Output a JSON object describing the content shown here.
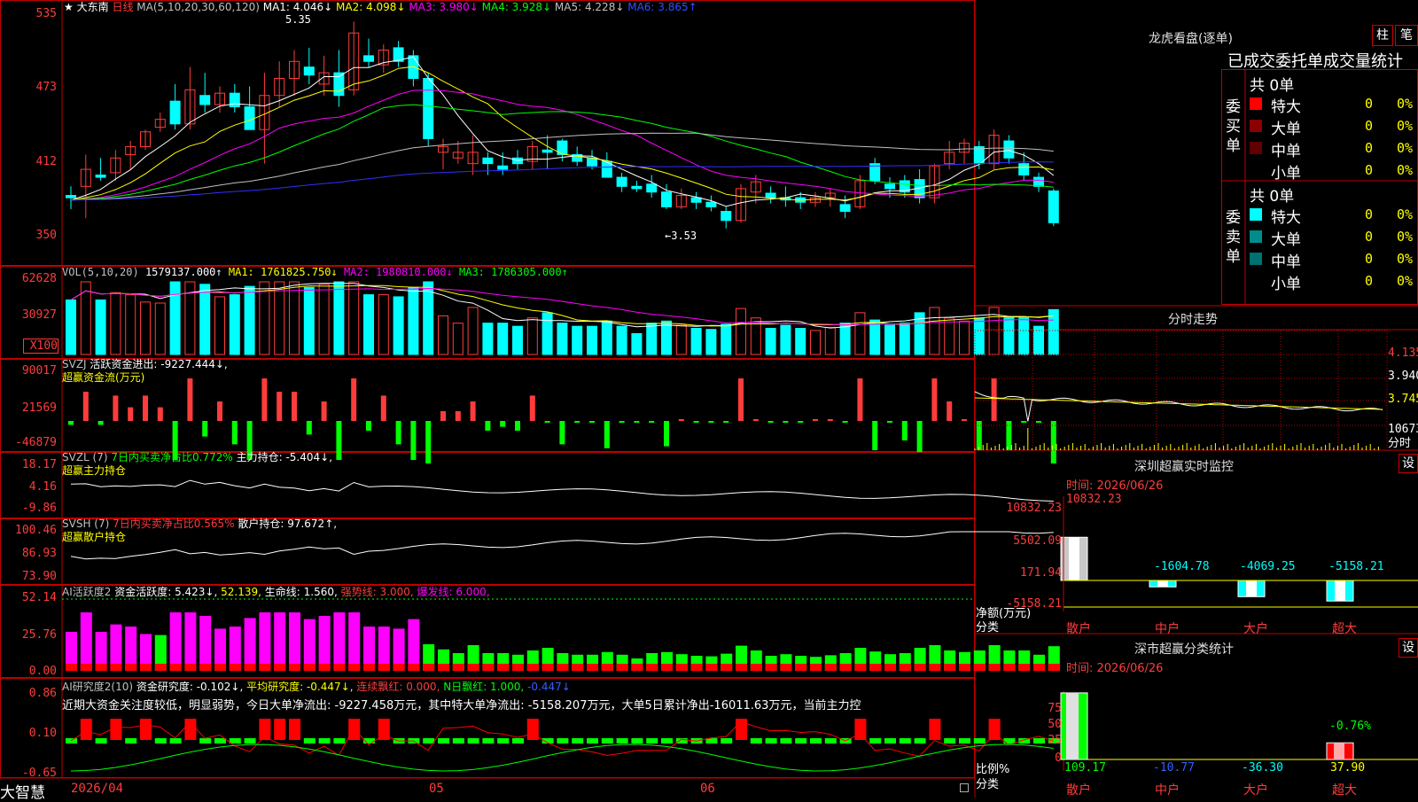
{
  "colors": {
    "up": "#ff3c3c",
    "down": "#00ffff",
    "frame": "#c00000",
    "ma5": "#ffffff",
    "ma10": "#ffff00",
    "ma20": "#ff00ff",
    "ma30": "#00ff00",
    "ma60": "#c0c0c0",
    "ma120": "#3030ff"
  },
  "header": {
    "stock_name": "大东南",
    "period": "日线",
    "ma_params": "MA(5,10,20,30,60,120)",
    "ma1": "MA1: 4.046↓",
    "ma2": "MA2: 4.098↓",
    "ma3": "MA3: 3.980↓",
    "ma4": "MA4: 3.928↓",
    "ma5": "MA5: 4.228↓",
    "ma6": "MA6: 3.865↑",
    "high_mark": "5.35",
    "low_mark": "←3.53"
  },
  "price_axis": [
    "535",
    "473",
    "412",
    "350"
  ],
  "vol": {
    "title": "VOL(5,10,20)",
    "value": "1579137.000↑",
    "ma1": "MA1: 1761825.750↓",
    "ma2": "MA2: 1980810.000↓",
    "ma3": "MA3: 1786305.000↑",
    "axis": [
      "62628",
      "30927"
    ],
    "unit": "X100"
  },
  "svzj": {
    "title": "SVZJ",
    "label": "活跃资金进出: -9227.444↓,",
    "sub": "超赢资金流(万元)",
    "axis": [
      "90017",
      "21569",
      "-46879"
    ]
  },
  "svzl": {
    "title": "SVZL (7)",
    "ratio": "7日内买卖净占比0.772%",
    "label": "主力持仓: -5.404↓,",
    "sub": "超赢主力持仓",
    "axis": [
      "18.17",
      "4.16",
      "-9.86"
    ]
  },
  "svsh": {
    "title": "SVSH (7)",
    "ratio": "7日内买卖净占比0.565%",
    "label": "散户持仓: 97.672↑,",
    "sub": "超赢散户持仓",
    "axis": [
      "100.46",
      "86.93",
      "73.90"
    ]
  },
  "ai2": {
    "title": "AI活跃度2",
    "label": "资金活跃度: 5.423↓,",
    "v2": "52.139,",
    "life": "生命线: 1.560,",
    "strong": "强势线: 3.000,",
    "burst": "爆发线: 6.000,",
    "axis": [
      "52.14",
      "25.76",
      "0.00"
    ]
  },
  "ai_res": {
    "title": "AI研究度2(10)",
    "label": "资金研究度: -0.102↓,",
    "avg": "平均研究度: -0.447↓,",
    "cont": "连续飘红: 0.000,",
    "nday": "N日飘红: 1.000,",
    "last": "-0.447↓",
    "axis": [
      "0.86",
      "0.10",
      "-0.65"
    ],
    "comment": "近期大资金关注度较低，明显弱势，今日大单净流出: -9227.458万元，其中特大单净流出: -5158.207万元，大单5日累计净出-16011.63万元，当前主力控"
  },
  "dates": [
    "2026/04",
    "05",
    "06"
  ],
  "brand": "大智慧",
  "right": {
    "lh_title": "龙虎看盘(逐单)",
    "btn1": "柱",
    "btn2": "笔",
    "table_title": "已成交委托单成交量统计",
    "buy_label": "委买单",
    "sell_label": "委卖单",
    "buy_total": "共 0单",
    "sell_total": "共 0单",
    "buy_rows": [
      {
        "name": "特大",
        "count": "0",
        "pct": "0%"
      },
      {
        "name": "大单",
        "count": "0",
        "pct": "0%"
      },
      {
        "name": "中单",
        "count": "0",
        "pct": "0%"
      },
      {
        "name": "小单",
        "count": "0",
        "pct": "0%"
      }
    ],
    "sell_rows": [
      {
        "name": "特大",
        "count": "0",
        "pct": "0%"
      },
      {
        "name": "大单",
        "count": "0",
        "pct": "0%"
      },
      {
        "name": "中单",
        "count": "0",
        "pct": "0%"
      },
      {
        "name": "小单",
        "count": "0",
        "pct": "0%"
      }
    ],
    "fs_title": "分时走势",
    "fs_axis": [
      "4.135",
      "3.940",
      "3.745",
      "10673"
    ],
    "fs_unit": "分时",
    "monitor_title": "深圳超赢实时监控",
    "monitor_btn": "设",
    "monitor_time": "时间: 2026/06/26",
    "monitor_axis": [
      "10832.23",
      "5502.09",
      "171.94",
      "-5158.21"
    ],
    "monitor_top": "10832.23",
    "monitor_values": [
      {
        "label": "散户",
        "value": "10832.23",
        "num": 10832.23
      },
      {
        "label": "中户",
        "value": "-1604.78",
        "num": -1604.78
      },
      {
        "label": "大户",
        "value": "-4069.25",
        "num": -4069.25
      },
      {
        "label": "超大",
        "value": "-5158.21",
        "num": -5158.21
      }
    ],
    "monitor_ylabel": "净额(万元)",
    "monitor_xlabel": "分类",
    "stat_title": "深市超赢分类统计",
    "stat_btn": "设",
    "stat_time": "时间: 2026/06/26",
    "stat_axis": [
      "75",
      "50",
      "25",
      "0"
    ],
    "stat_ylabel": "比例%",
    "stat_xlabel": "分类",
    "stat_values": [
      {
        "label": "散户",
        "value": "109.17",
        "num": 109.17
      },
      {
        "label": "中户",
        "value": "-10.77",
        "num": -10.77
      },
      {
        "label": "大户",
        "value": "-36.30",
        "num": -36.3
      },
      {
        "label": "超大",
        "value": "37.90",
        "num": 37.9
      }
    ],
    "stat_top": "-0.76%"
  },
  "chart_data": {
    "type": "bar",
    "title": "大东南 日线",
    "candles": [
      [
        3.82,
        3.9,
        3.7,
        3.8
      ],
      [
        3.9,
        4.18,
        3.62,
        4.05
      ],
      [
        4.0,
        4.15,
        3.95,
        3.98
      ],
      [
        4.02,
        4.22,
        3.95,
        4.15
      ],
      [
        4.18,
        4.3,
        4.05,
        4.25
      ],
      [
        4.25,
        4.4,
        4.22,
        4.38
      ],
      [
        4.42,
        4.55,
        4.38,
        4.49
      ],
      [
        4.65,
        4.8,
        4.4,
        4.45
      ],
      [
        4.45,
        4.95,
        4.4,
        4.75
      ],
      [
        4.7,
        4.9,
        4.55,
        4.62
      ],
      [
        4.62,
        4.78,
        4.55,
        4.72
      ],
      [
        4.72,
        4.8,
        4.55,
        4.6
      ],
      [
        4.6,
        4.78,
        4.45,
        4.4
      ],
      [
        4.4,
        4.9,
        4.1,
        4.7
      ],
      [
        4.7,
        5.0,
        4.6,
        4.85
      ],
      [
        4.85,
        5.1,
        4.7,
        5.0
      ],
      [
        4.95,
        5.12,
        4.8,
        4.88
      ],
      [
        4.8,
        5.05,
        4.7,
        4.9
      ],
      [
        4.9,
        5.1,
        4.6,
        4.7
      ],
      [
        4.75,
        5.35,
        4.7,
        5.25
      ],
      [
        5.05,
        5.2,
        4.95,
        5.0
      ],
      [
        4.97,
        5.15,
        4.9,
        5.1
      ],
      [
        5.12,
        5.18,
        4.95,
        5.0
      ],
      [
        5.05,
        5.1,
        4.78,
        4.85
      ],
      [
        4.85,
        4.9,
        4.25,
        4.32
      ],
      [
        4.2,
        4.32,
        4.05,
        4.25
      ],
      [
        4.15,
        4.3,
        4.1,
        4.2
      ],
      [
        4.1,
        4.35,
        4.0,
        4.2
      ],
      [
        4.15,
        4.2,
        4.0,
        4.1
      ],
      [
        4.08,
        4.2,
        4.0,
        4.05
      ],
      [
        4.15,
        4.22,
        4.05,
        4.1
      ],
      [
        4.12,
        4.3,
        4.05,
        4.25
      ],
      [
        4.22,
        4.35,
        4.05,
        4.2
      ],
      [
        4.3,
        4.32,
        4.12,
        4.18
      ],
      [
        4.18,
        4.25,
        4.08,
        4.12
      ],
      [
        4.15,
        4.22,
        4.05,
        4.08
      ],
      [
        4.12,
        4.2,
        3.98,
        3.98
      ],
      [
        3.98,
        4.02,
        3.85,
        3.9
      ],
      [
        3.9,
        3.95,
        3.85,
        3.88
      ],
      [
        3.92,
        4.0,
        3.8,
        3.85
      ],
      [
        3.85,
        3.92,
        3.7,
        3.72
      ],
      [
        3.72,
        3.88,
        3.7,
        3.82
      ],
      [
        3.8,
        3.85,
        3.7,
        3.76
      ],
      [
        3.76,
        3.82,
        3.68,
        3.72
      ],
      [
        3.68,
        3.72,
        3.53,
        3.6
      ],
      [
        3.6,
        3.92,
        3.58,
        3.88
      ],
      [
        3.85,
        4.0,
        3.75,
        3.94
      ],
      [
        3.84,
        3.9,
        3.75,
        3.8
      ],
      [
        3.8,
        3.9,
        3.72,
        3.78
      ],
      [
        3.8,
        3.85,
        3.7,
        3.76
      ],
      [
        3.76,
        3.85,
        3.72,
        3.8
      ],
      [
        3.8,
        3.88,
        3.72,
        3.84
      ],
      [
        3.74,
        3.82,
        3.62,
        3.68
      ],
      [
        3.72,
        4.0,
        3.7,
        3.95
      ],
      [
        4.1,
        4.15,
        3.92,
        3.95
      ],
      [
        3.92,
        3.98,
        3.8,
        3.88
      ],
      [
        3.95,
        4.0,
        3.8,
        3.85
      ],
      [
        3.96,
        4.05,
        3.75,
        3.8
      ],
      [
        3.8,
        4.1,
        3.75,
        4.08
      ],
      [
        4.1,
        4.3,
        4.05,
        4.2
      ],
      [
        4.2,
        4.32,
        4.1,
        4.28
      ],
      [
        4.25,
        4.3,
        4.05,
        4.1
      ],
      [
        4.1,
        4.4,
        4.05,
        4.35
      ],
      [
        4.3,
        4.35,
        4.1,
        4.15
      ],
      [
        4.1,
        4.2,
        3.95,
        4.0
      ],
      [
        3.98,
        4.02,
        3.85,
        3.9
      ],
      [
        3.86,
        3.88,
        3.55,
        3.58
      ]
    ],
    "vol_axis": [
      0,
      62628
    ]
  }
}
